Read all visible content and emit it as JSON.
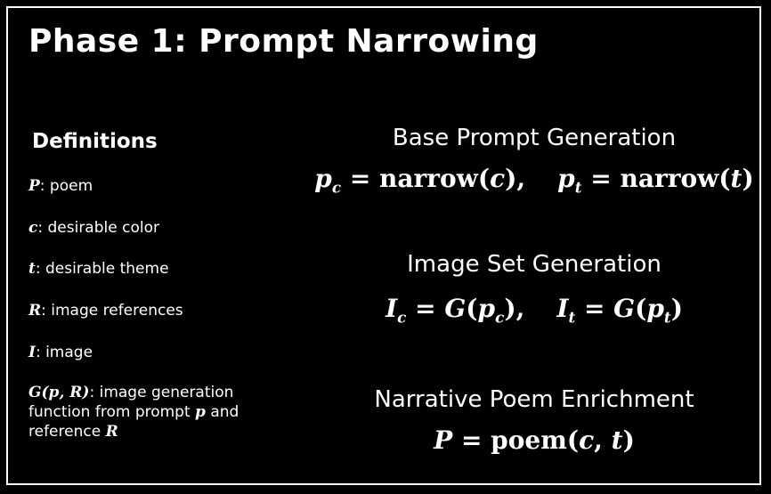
{
  "title": "Phase 1: Prompt Narrowing",
  "definitions": {
    "heading": "Definitions",
    "items": [
      {
        "symbol": "P",
        "text": ": poem"
      },
      {
        "symbol": "c",
        "text": ": desirable color"
      },
      {
        "symbol": "t",
        "text": ": desirable theme"
      },
      {
        "symbol": "R",
        "text": ": image references"
      },
      {
        "symbol": "I",
        "text": ": image"
      },
      {
        "symbol": "G(p, R)",
        "text": ": image generation function from prompt",
        "sym2": "p",
        "text2": " and reference ",
        "sym3": "R"
      }
    ]
  },
  "sections": [
    {
      "heading": "Base Prompt Generation"
    },
    {
      "heading": "Image Set Generation"
    },
    {
      "heading": "Narrative Poem Enrichment"
    }
  ]
}
